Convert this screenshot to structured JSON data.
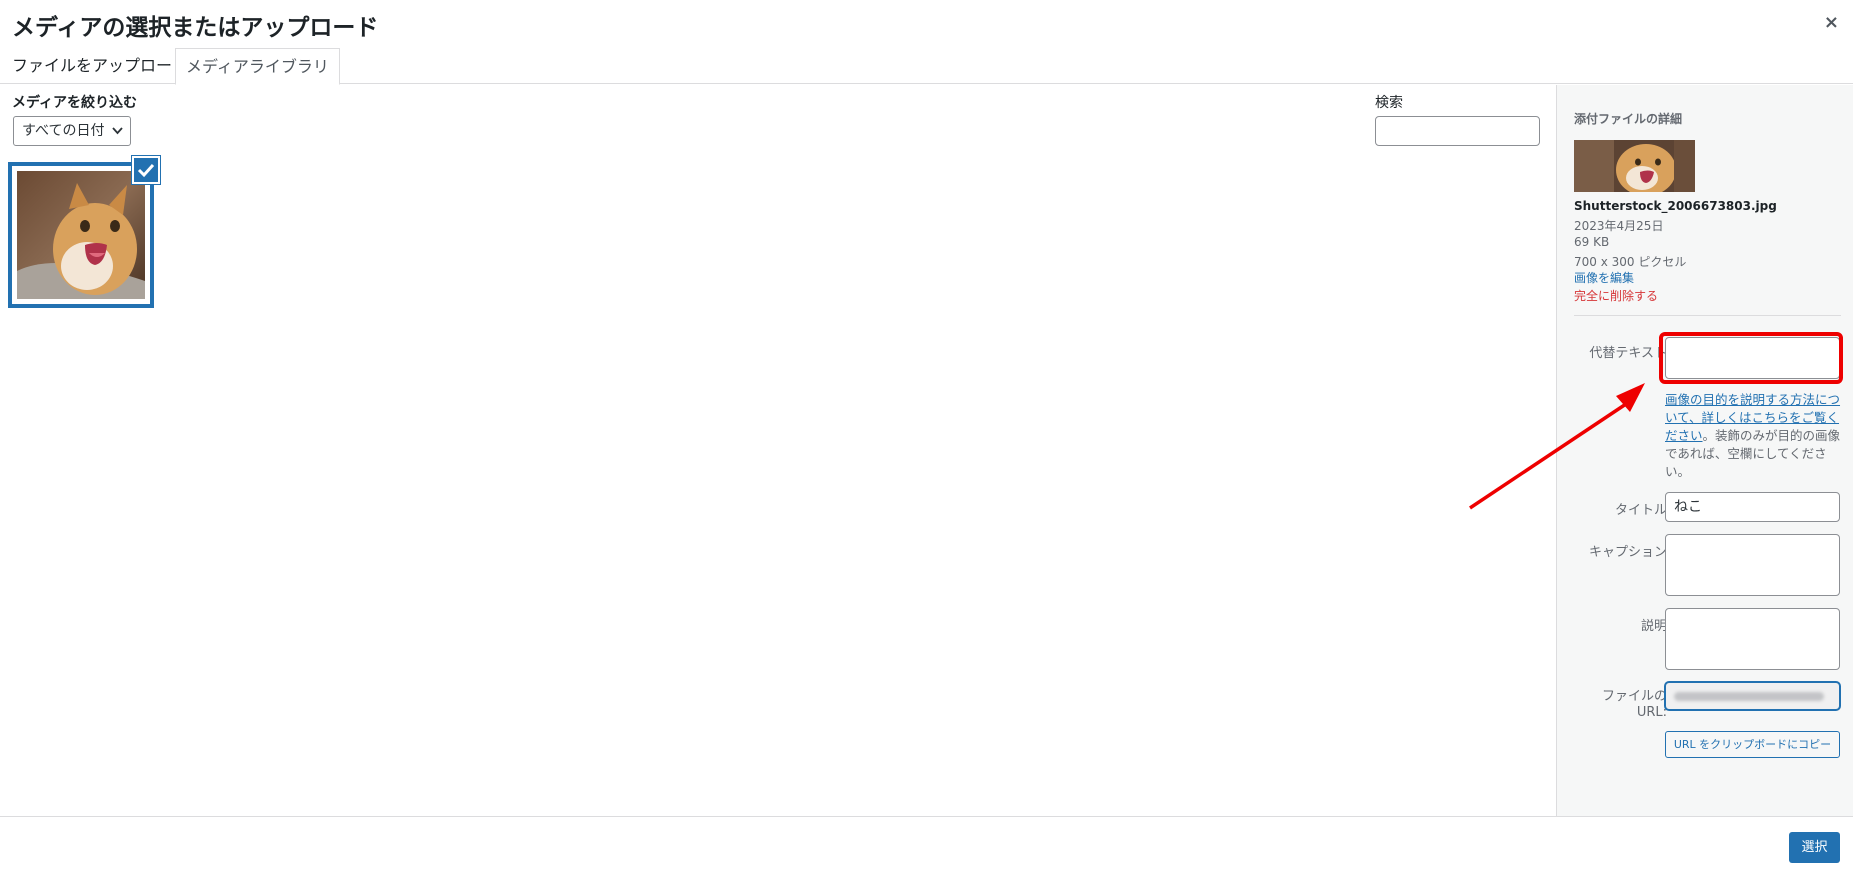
{
  "modal": {
    "title": "メディアの選択またはアップロード",
    "close_symbol": "×"
  },
  "tabs": [
    {
      "label": "ファイルをアップロード",
      "active": false
    },
    {
      "label": "メディアライブラリ",
      "active": true
    }
  ],
  "filter": {
    "label": "メディアを絞り込む",
    "date_selected": "すべての日付"
  },
  "search": {
    "label": "検索",
    "value": ""
  },
  "library": {
    "items": [
      {
        "name": "Shutterstock_2006673803.jpg",
        "selected": true
      }
    ]
  },
  "details": {
    "heading": "添付ファイルの詳細",
    "filename": "Shutterstock_2006673803.jpg",
    "date": "2023年4月25日",
    "size": "69 KB",
    "dimensions": "700 x 300 ピクセル",
    "edit_link": "画像を編集",
    "delete_link": "完全に削除する",
    "alt_text_label": "代替テキスト",
    "alt_text_value": "",
    "help_link": "画像の目的を説明する方法について、詳しくはこちらをご覧ください",
    "help_text": "。装飾のみが目的の画像であれば、空欄にしてください。",
    "title_label": "タイトル",
    "title_value": "ねこ",
    "caption_label": "キャプション",
    "caption_value": "",
    "description_label": "説明",
    "description_value": "",
    "url_label_line1": "ファイルの",
    "url_label_line2": "URL:",
    "copy_button": "URL をクリップボードにコピー"
  },
  "footer": {
    "select_button": "選択"
  },
  "colors": {
    "accent": "#2271b1",
    "danger": "#d63638",
    "annotation": "#ee0000"
  },
  "icons": {
    "close": "close-icon",
    "dropdown": "chevron-down-icon",
    "checkmark": "checkmark-icon"
  }
}
